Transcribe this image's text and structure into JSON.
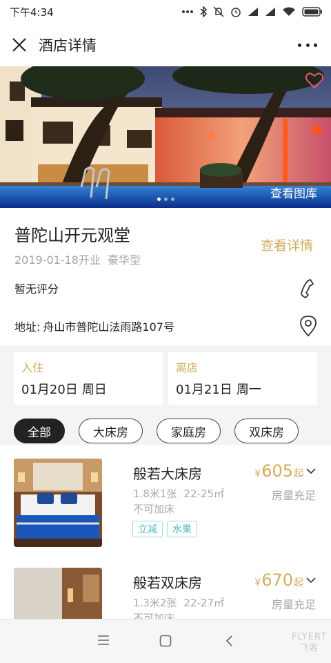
{
  "status_bar": {
    "time": "下午4:34",
    "icons": [
      "dots-icon",
      "bluetooth-icon",
      "mute-icon",
      "alarm-icon",
      "signal-icon",
      "hd-signal-icon",
      "wifi-icon",
      "battery-icon"
    ]
  },
  "nav": {
    "title": "酒店详情",
    "close_icon": "close-icon",
    "more_icon": "more-icon"
  },
  "hero": {
    "gallery_label": "查看图库",
    "favorite_icon": "heart-icon",
    "slide_count": 3,
    "active_slide": 1
  },
  "hotel": {
    "name": "普陀山开元观堂",
    "opened": "2019-01-18开业",
    "category": "豪华型",
    "detail_link": "查看详情",
    "rating": "暂无评分",
    "address_label": "地址:",
    "address": "舟山市普陀山法雨路107号"
  },
  "dates": {
    "checkin": {
      "label": "入住",
      "date": "01月20日",
      "weekday": "周日"
    },
    "checkout": {
      "label": "离店",
      "date": "01月21日",
      "weekday": "周一"
    }
  },
  "filters": [
    {
      "label": "全部",
      "active": true
    },
    {
      "label": "大床房",
      "active": false
    },
    {
      "label": "家庭房",
      "active": false
    },
    {
      "label": "双床房",
      "active": false
    }
  ],
  "rooms": [
    {
      "name": "般若大床房",
      "beds": "1.8米1张",
      "area": "22-25㎡",
      "extra": "不可加床",
      "tags": [
        "立减",
        "水果"
      ],
      "currency": "¥",
      "price": "605",
      "price_suffix": "起",
      "availability": "房量充足"
    },
    {
      "name": "般若双床房",
      "beds": "1.3米2张",
      "area": "22-27㎡",
      "extra": "不可加床",
      "tags": [],
      "currency": "¥",
      "price": "670",
      "price_suffix": "起",
      "availability": "房量充足"
    }
  ],
  "watermark": {
    "line1": "FLYERT",
    "line2": "飞客"
  },
  "colors": {
    "accent": "#d4ad5d",
    "tag": "#4fb9c4",
    "dark": "#222222",
    "muted": "#a4a4a4"
  }
}
